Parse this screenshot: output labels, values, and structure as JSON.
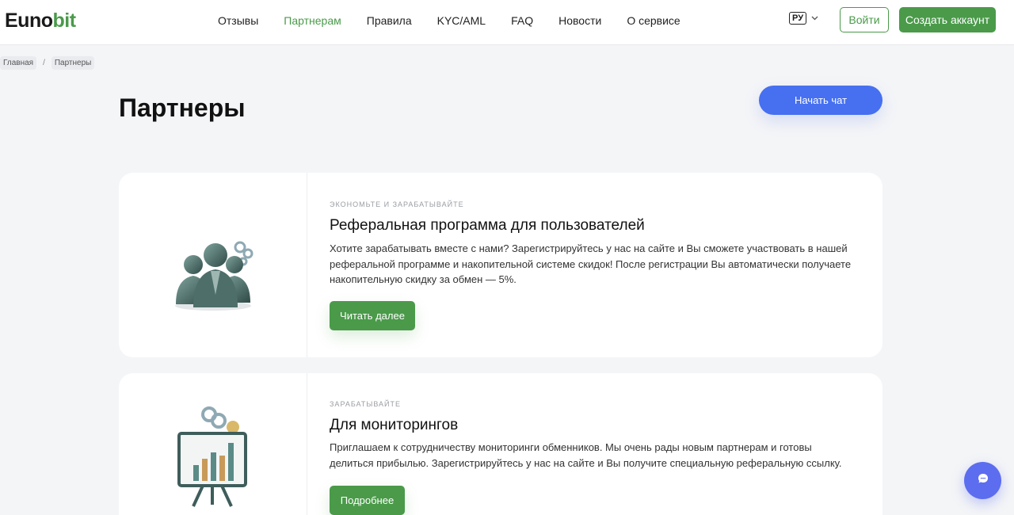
{
  "header": {
    "logo_main": "Euno",
    "logo_accent": "bit",
    "nav": [
      {
        "label": "Отзывы"
      },
      {
        "label": "Партнерам"
      },
      {
        "label": "Правила"
      },
      {
        "label": "KYC/AML"
      },
      {
        "label": "FAQ"
      },
      {
        "label": "Новости"
      },
      {
        "label": "О сервисе"
      }
    ],
    "active_nav": "Партнерам",
    "lang": "РУ",
    "login_label": "Войти",
    "signup_label": "Создать аккаунт"
  },
  "breadcrumb": {
    "home": "Главная",
    "separator": "/",
    "current": "Партнеры"
  },
  "page": {
    "title": "Партнеры",
    "chat_button_label": "Начать чат"
  },
  "cards": [
    {
      "eyebrow": "Экономьте и зарабатывайте",
      "title": "Реферальная программа для пользователей",
      "text": "Хотите зарабатывать вместе с нами? Зарегистрируйтесь у нас на сайте и Вы сможете участвовать в нашей реферальной программе и накопительной системе скидок! После регистрации Вы автоматически получаете накопительную скидку за обмен — 5%.",
      "button_label": "Читать далее",
      "icon": "people-group-icon"
    },
    {
      "eyebrow": "Зарабатывайте",
      "title": "Для мониторингов",
      "text": "Приглашаем к сотрудничеству мониторинги обменников. Мы очень рады новым партнерам и готовы делиться прибылью. Зарегистрируйтесь у нас на сайте и Вы получите специальную реферальную ссылку.",
      "button_label": "Подробнее",
      "icon": "presentation-chart-icon"
    }
  ],
  "colors": {
    "brand_green": "#4a9a4a",
    "chat_blue": "#4670f0",
    "fab_purple": "#5d6df0"
  },
  "chat_fab_icon": "chat-bubble-icon"
}
